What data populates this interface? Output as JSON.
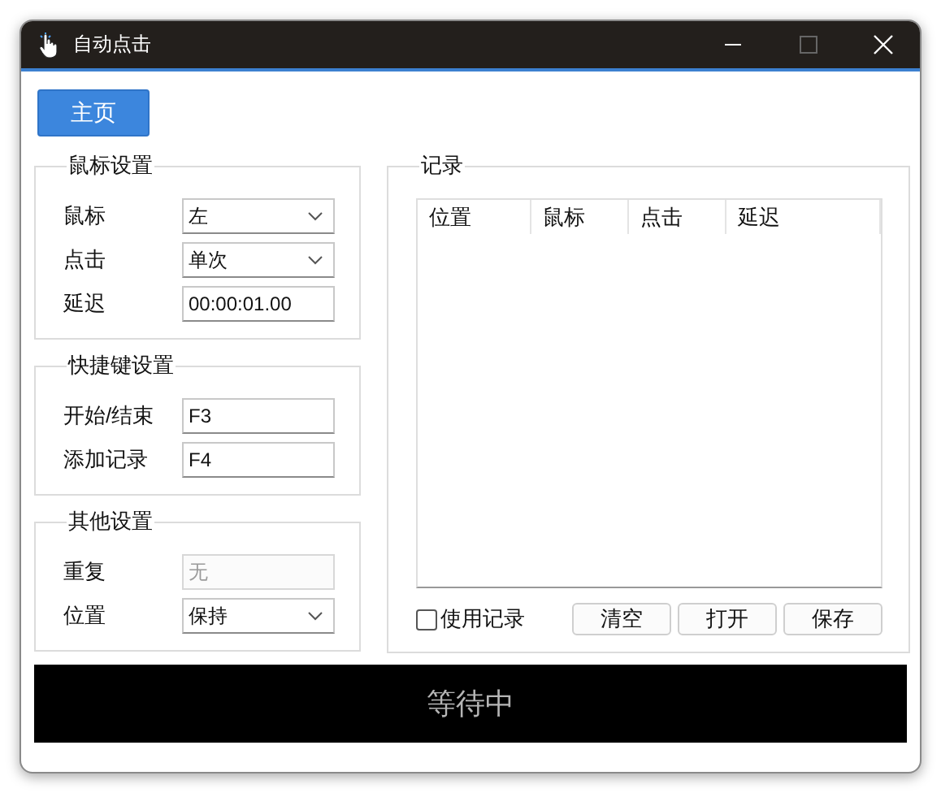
{
  "window": {
    "title": "自动点击"
  },
  "nav_button": {
    "label": "主页"
  },
  "groups": [
    {
      "title": "鼠标设置",
      "fields": [
        {
          "label": "鼠标",
          "kind": "dropdown",
          "value": "左",
          "disabled": false
        },
        {
          "label": "点击",
          "kind": "dropdown",
          "value": "单次",
          "disabled": false
        },
        {
          "label": "延迟",
          "kind": "text",
          "value": "00:00:01.00",
          "disabled": false
        }
      ]
    },
    {
      "title": "快捷键设置",
      "fields": [
        {
          "label": "开始/结束",
          "kind": "text",
          "value": "F3",
          "disabled": false
        },
        {
          "label": "添加记录",
          "kind": "text",
          "value": "F4",
          "disabled": false
        }
      ]
    },
    {
      "title": "其他设置",
      "fields": [
        {
          "label": "重复",
          "kind": "text",
          "value": "无",
          "disabled": true
        },
        {
          "label": "位置",
          "kind": "dropdown",
          "value": "保持",
          "disabled": false
        }
      ]
    }
  ],
  "records": {
    "title": "记录",
    "columns": [
      "位置",
      "鼠标",
      "点击",
      "延迟"
    ],
    "use_records": {
      "label": "使用记录",
      "checked": false
    },
    "buttons": [
      "清空",
      "打开",
      "保存"
    ]
  },
  "status": "等待中"
}
